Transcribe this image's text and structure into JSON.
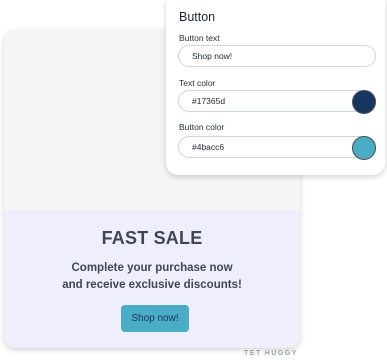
{
  "preview": {
    "headline": "FAST SALE",
    "subtext_line1": "Complete your purchase now",
    "subtext_line2": "and receive exclusive discounts!",
    "cta_label": "Shop now!"
  },
  "settings": {
    "title": "Button",
    "button_text_label": "Button text",
    "button_text_value": "Shop now!",
    "text_color_label": "Text color",
    "text_color_value": "#17365d",
    "button_color_label": "Button color",
    "button_color_value": "#4bacc6"
  },
  "colors": {
    "text_color": "#17365d",
    "button_color": "#4bacc6"
  },
  "logo": {
    "mark": "TET",
    "name": "HUGGY"
  }
}
